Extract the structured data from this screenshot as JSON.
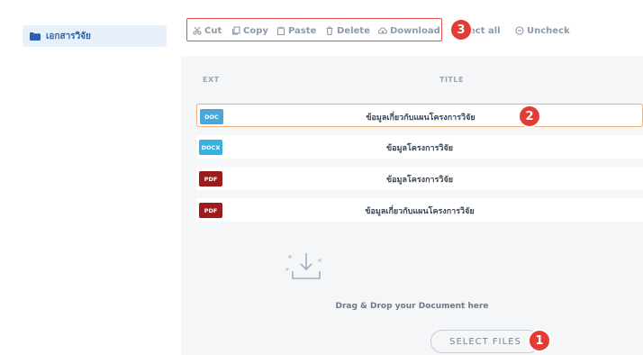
{
  "sidebar": {
    "folder_label": "เอกสารวิจัย"
  },
  "toolbar": {
    "cut": "Cut",
    "copy": "Copy",
    "paste": "Paste",
    "delete": "Delete",
    "download": "Download",
    "select_all": "ect all",
    "uncheck": "Uncheck"
  },
  "table": {
    "headers": {
      "ext": "EXT",
      "title": "TITLE"
    },
    "rows": [
      {
        "ext": "DOC",
        "title": "ข้อมูลเกี่ยวกับแผนโครงการวิจัย",
        "color": "#4aa8d8",
        "selected": true
      },
      {
        "ext": "DOCX",
        "title": "ข้อมูลโครงการวิจัย",
        "color": "#35b2e0",
        "selected": false
      },
      {
        "ext": "PDF",
        "title": "ข้อมูลโครงการวิจัย",
        "color": "#9e1b1b",
        "selected": false
      },
      {
        "ext": "PDF",
        "title": "ข้อมูลเกี่ยวกับแผนโครงการวิจัย",
        "color": "#9e1b1b",
        "selected": false
      }
    ]
  },
  "dropzone": {
    "text": "Drag & Drop your Document here",
    "button": "SELECT FILES"
  },
  "markers": {
    "m1": "1",
    "m2": "2",
    "m3": "3"
  },
  "colors": {
    "accent": "#e23c35",
    "highlight_border": "#e05252",
    "folder": "#2b5fb0"
  }
}
